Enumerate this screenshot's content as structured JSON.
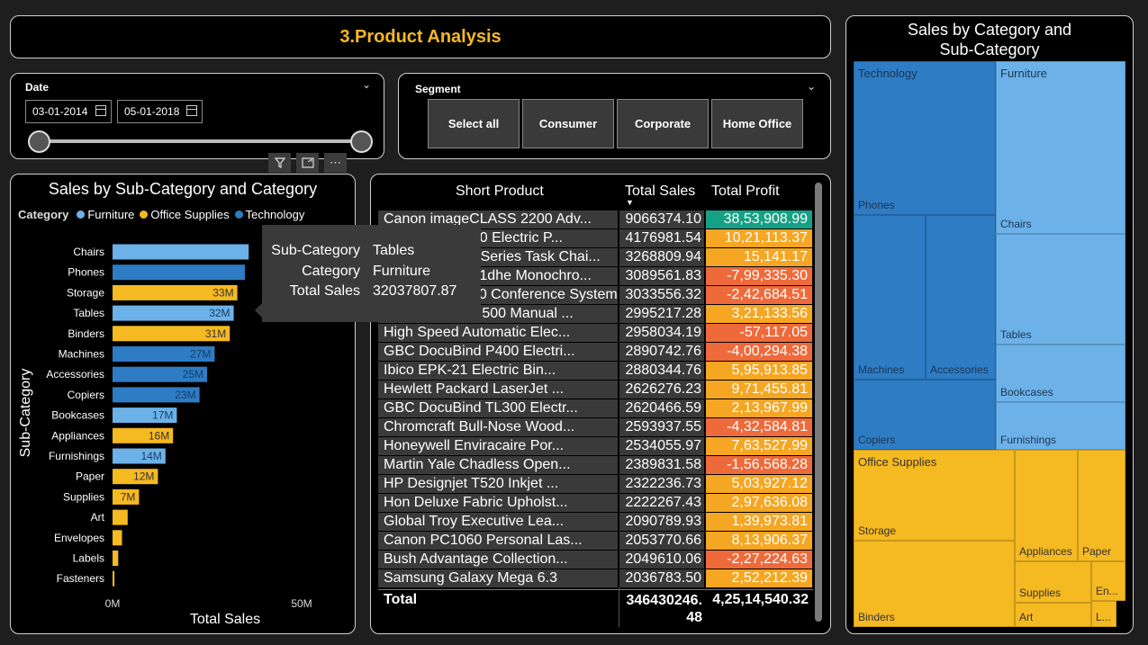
{
  "page_title": "3.Product Analysis",
  "date_slicer": {
    "label": "Date",
    "start": "03-01-2014",
    "end": "05-01-2018"
  },
  "segment_slicer": {
    "label": "Segment",
    "options": [
      "Select all",
      "Consumer",
      "Corporate",
      "Home Office"
    ]
  },
  "visual_header_icons": [
    "filter-icon",
    "focus-mode-icon",
    "more-options-icon"
  ],
  "bar_chart": {
    "title": "Sales by Sub-Category and Category",
    "legend_label": "Category",
    "ylabel": "Sub-Category",
    "xlabel": "Total Sales",
    "x_ticks": [
      "0M",
      "50M"
    ]
  },
  "tooltip": {
    "rows": [
      {
        "key": "Sub-Category",
        "value": "Tables"
      },
      {
        "key": "Category",
        "value": "Furniture"
      },
      {
        "key": "Total Sales",
        "value": "32037807.87"
      }
    ]
  },
  "colors": {
    "furniture": "#6cb2e8",
    "office_supplies": "#f5b921",
    "technology": "#2d7cc4",
    "profit_high": "#16a085",
    "profit_mid": "#f5a623",
    "profit_low": "#ef6a3a"
  },
  "chart_data": {
    "type": "bar",
    "orientation": "horizontal",
    "title": "Sales by Sub-Category and Category",
    "xlabel": "Total Sales",
    "ylabel": "Sub-Category",
    "xlim": [
      0,
      50000000
    ],
    "legend_title": "Category",
    "legend_position": "top",
    "series_names": [
      "Furniture",
      "Office Supplies",
      "Technology"
    ],
    "categories": [
      "Chairs",
      "Phones",
      "Storage",
      "Tables",
      "Binders",
      "Machines",
      "Accessories",
      "Copiers",
      "Bookcases",
      "Appliances",
      "Furnishings",
      "Paper",
      "Supplies",
      "Art",
      "Envelopes",
      "Labels",
      "Fasteners"
    ],
    "category_group": [
      "Furniture",
      "Technology",
      "Office Supplies",
      "Furniture",
      "Office Supplies",
      "Technology",
      "Technology",
      "Technology",
      "Furniture",
      "Office Supplies",
      "Furniture",
      "Office Supplies",
      "Office Supplies",
      "Office Supplies",
      "Office Supplies",
      "Office Supplies",
      "Office Supplies"
    ],
    "values": [
      36000000,
      35000000,
      33000000,
      32037807.87,
      31000000,
      27000000,
      25000000,
      23000000,
      17000000,
      16000000,
      14000000,
      12000000,
      7000000,
      4000000,
      2500000,
      1500000,
      500000
    ],
    "data_labels": [
      "",
      "",
      "33M",
      "32M",
      "31M",
      "27M",
      "25M",
      "23M",
      "17M",
      "16M",
      "14M",
      "12M",
      "7M",
      "",
      "",
      "",
      ""
    ]
  },
  "table": {
    "headers": [
      "Short Product",
      "Total Sales",
      "Total Profit"
    ],
    "rows": [
      {
        "product": "Canon imageCLASS 2200 Adv...",
        "sales": "9066374.10",
        "profit": "38,53,908.99",
        "level": "high"
      },
      {
        "product": "Fellowes PB500 Electric P...",
        "sales": "4176981.54",
        "profit": "10,21,113.37",
        "level": "mid"
      },
      {
        "product": "Hon Executive Series Task Chai...",
        "sales": "3268809.94",
        "profit": "15,141.17",
        "level": "mid"
      },
      {
        "product": "Lexmark MX611dhe Monochro...",
        "sales": "3089561.83",
        "profit": "-7,99,335.30",
        "level": "low"
      },
      {
        "product": "Polycom CX600 Conference System...",
        "sales": "3033556.32",
        "profit": "-2,42,684.51",
        "level": "low"
      },
      {
        "product": "GBC Ibimaster 500 Manual ...",
        "sales": "2995217.28",
        "profit": "3,21,133.56",
        "level": "mid"
      },
      {
        "product": "High Speed Automatic Elec...",
        "sales": "2958034.19",
        "profit": "-57,117.05",
        "level": "low"
      },
      {
        "product": "GBC DocuBind P400 Electri...",
        "sales": "2890742.76",
        "profit": "-4,00,294.38",
        "level": "low"
      },
      {
        "product": "Ibico EPK-21 Electric Bin...",
        "sales": "2880344.76",
        "profit": "5,95,913.85",
        "level": "mid"
      },
      {
        "product": "Hewlett Packard LaserJet ...",
        "sales": "2626276.23",
        "profit": "9,71,455.81",
        "level": "mid"
      },
      {
        "product": "GBC DocuBind TL300 Electr...",
        "sales": "2620466.59",
        "profit": "2,13,967.99",
        "level": "mid"
      },
      {
        "product": "Chromcraft Bull-Nose Wood...",
        "sales": "2593937.55",
        "profit": "-4,32,584.81",
        "level": "low"
      },
      {
        "product": "Honeywell Enviracaire Por...",
        "sales": "2534055.97",
        "profit": "7,63,527.99",
        "level": "mid"
      },
      {
        "product": "Martin Yale Chadless Open...",
        "sales": "2389831.58",
        "profit": "-1,56,568.28",
        "level": "low"
      },
      {
        "product": "HP Designjet T520 Inkjet ...",
        "sales": "2322236.73",
        "profit": "5,03,927.12",
        "level": "mid"
      },
      {
        "product": "Hon Deluxe Fabric Upholst...",
        "sales": "2222267.43",
        "profit": "2,97,636.08",
        "level": "mid"
      },
      {
        "product": "Global Troy Executive Lea...",
        "sales": "2090789.93",
        "profit": "1,39,973.81",
        "level": "mid"
      },
      {
        "product": "Canon PC1060 Personal Las...",
        "sales": "2053770.66",
        "profit": "8,13,906.37",
        "level": "mid"
      },
      {
        "product": "Bush Advantage Collection...",
        "sales": "2049610.06",
        "profit": "-2,27,224.63",
        "level": "low"
      },
      {
        "product": "Samsung Galaxy Mega 6.3",
        "sales": "2036783.50",
        "profit": "2,52,212.39",
        "level": "mid"
      }
    ],
    "total_label": "Total",
    "total_sales": "346430246.48",
    "total_profit": "4,25,14,540.32"
  },
  "treemap": {
    "title": "Sales by Category and Sub-Category",
    "tiles": [
      {
        "label": "Technology",
        "category": "technology"
      },
      {
        "label": "Phones",
        "category": "technology"
      },
      {
        "label": "Machines",
        "category": "technology"
      },
      {
        "label": "Accessories",
        "category": "technology"
      },
      {
        "label": "Copiers",
        "category": "technology"
      },
      {
        "label": "Furniture",
        "category": "furniture"
      },
      {
        "label": "Chairs",
        "category": "furniture"
      },
      {
        "label": "Tables",
        "category": "furniture"
      },
      {
        "label": "Bookcases",
        "category": "furniture"
      },
      {
        "label": "Furnishings",
        "category": "furniture"
      },
      {
        "label": "Office Supplies",
        "category": "office_supplies"
      },
      {
        "label": "Storage",
        "category": "office_supplies"
      },
      {
        "label": "Binders",
        "category": "office_supplies"
      },
      {
        "label": "Appliances",
        "category": "office_supplies"
      },
      {
        "label": "Paper",
        "category": "office_supplies"
      },
      {
        "label": "Supplies",
        "category": "office_supplies"
      },
      {
        "label": "Art",
        "category": "office_supplies"
      },
      {
        "label": "En...",
        "category": "office_supplies"
      },
      {
        "label": "L...",
        "category": "office_supplies"
      }
    ]
  }
}
